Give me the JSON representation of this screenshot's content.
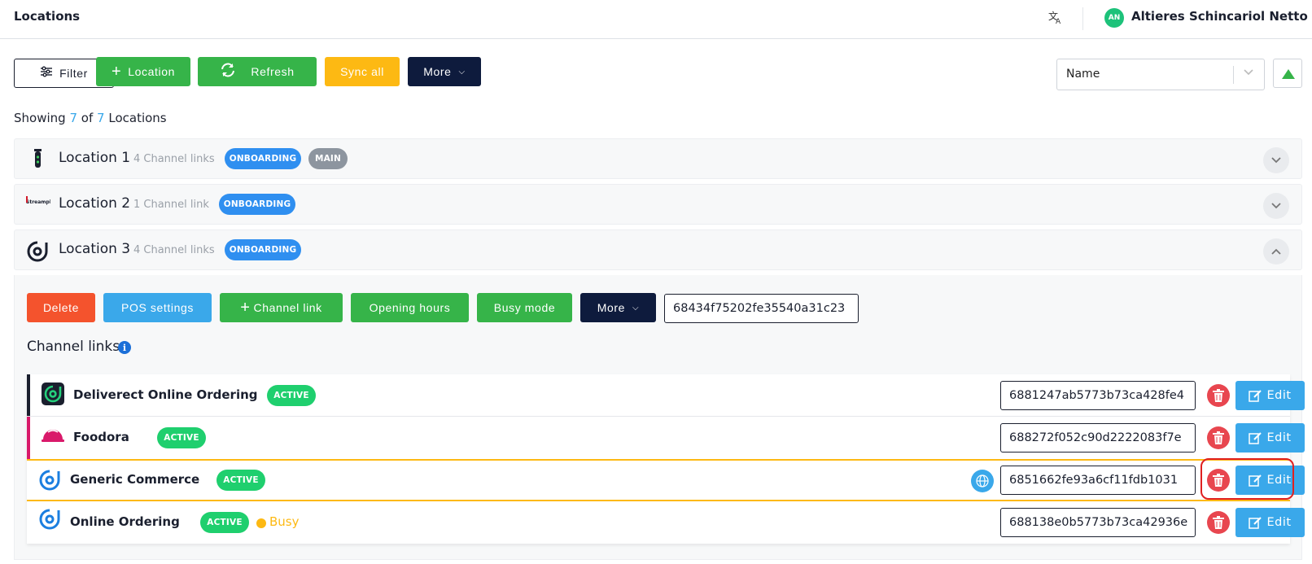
{
  "header": {
    "title": "Locations",
    "translate_icon": "translate-icon",
    "avatar_initials": "AN",
    "user_name": "Altieres Schincariol Netto"
  },
  "toolbar": {
    "filter_label": "Filter",
    "add_location_label": "Location",
    "refresh_label": "Refresh",
    "sync_all_label": "Sync all",
    "more_label": "More",
    "sort_value": "Name"
  },
  "showing": {
    "prefix": "Showing",
    "count": "7",
    "of": "of",
    "total": "7",
    "suffix": "Locations"
  },
  "locations": [
    {
      "name": "Location 1",
      "links": "4 Channel links",
      "badges": [
        "ONBOARDING",
        "MAIN"
      ]
    },
    {
      "name": "Location 2",
      "links": "1 Channel link",
      "badges": [
        "ONBOARDING"
      ]
    },
    {
      "name": "Location 3",
      "links": "4 Channel links",
      "badges": [
        "ONBOARDING"
      ]
    }
  ],
  "location_actions": {
    "delete_label": "Delete",
    "pos_settings_label": "POS settings",
    "channel_link_label": "Channel link",
    "opening_hours_label": "Opening hours",
    "busy_mode_label": "Busy mode",
    "more_label": "More",
    "location_id": "68434f75202fe35540a31c23"
  },
  "channel_links_title": "Channel links",
  "channels": [
    {
      "name": "Deliverect Online Ordering",
      "status": "ACTIVE",
      "id": "6881247ab5773b73ca428fe4",
      "edit_label": "Edit",
      "bar_color": "#1a1f2e"
    },
    {
      "name": "Foodora",
      "status": "ACTIVE",
      "id": "688272f052c90d2222083f7e",
      "edit_label": "Edit",
      "bar_color": "#d9196a"
    },
    {
      "name": "Generic Commerce",
      "status": "ACTIVE",
      "id": "6851662fe93a6cf11fdb1031",
      "edit_label": "Edit",
      "bar_color": "#fdb913"
    },
    {
      "name": "Online Ordering",
      "status": "ACTIVE",
      "busy": "Busy",
      "id": "688138e0b5773b73ca42936e",
      "edit_label": "Edit",
      "bar_color": "#ffffff"
    }
  ],
  "colors": {
    "green": "#36b449",
    "navy": "#0e1b3d",
    "yellow": "#fdb913",
    "blue": "#3aa8ea",
    "red": "#f4532d",
    "badge_blue": "#2f8ff0",
    "active_green": "#1fcf6e"
  }
}
